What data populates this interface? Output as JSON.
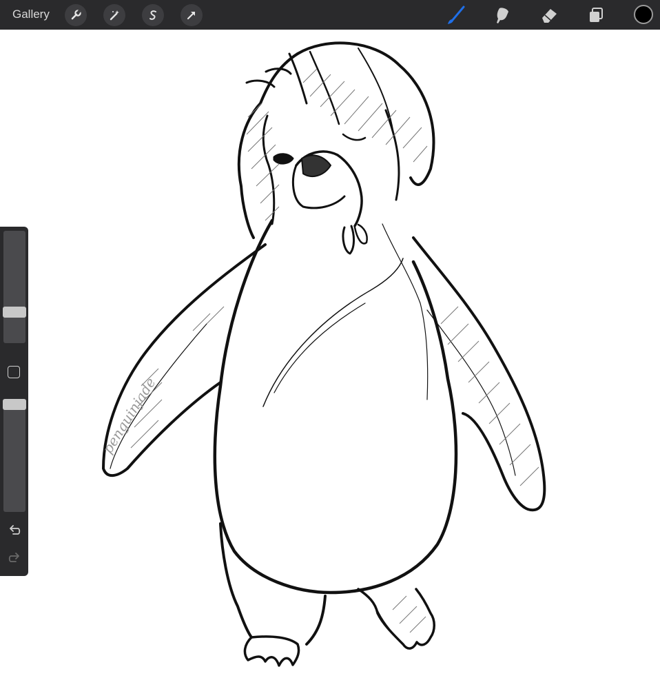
{
  "topbar": {
    "gallery_label": "Gallery",
    "left_tools": [
      {
        "name": "actions-wrench-icon"
      },
      {
        "name": "adjustments-wand-icon"
      },
      {
        "name": "selection-icon"
      },
      {
        "name": "transform-arrow-icon"
      }
    ],
    "right_tools": [
      {
        "name": "brush-icon",
        "active": true
      },
      {
        "name": "smudge-icon",
        "active": false
      },
      {
        "name": "eraser-icon",
        "active": false
      },
      {
        "name": "layers-icon",
        "active": false
      }
    ],
    "current_color": "#000000",
    "accent_color": "#1f6fe8"
  },
  "sidebar": {
    "brush_size_level": 0.25,
    "opacity_level": 1.0,
    "undo_icon": "undo-icon",
    "redo_icon": "redo-icon"
  },
  "canvas": {
    "watermark": "penguinjade",
    "subject": "penguin-sketch"
  }
}
